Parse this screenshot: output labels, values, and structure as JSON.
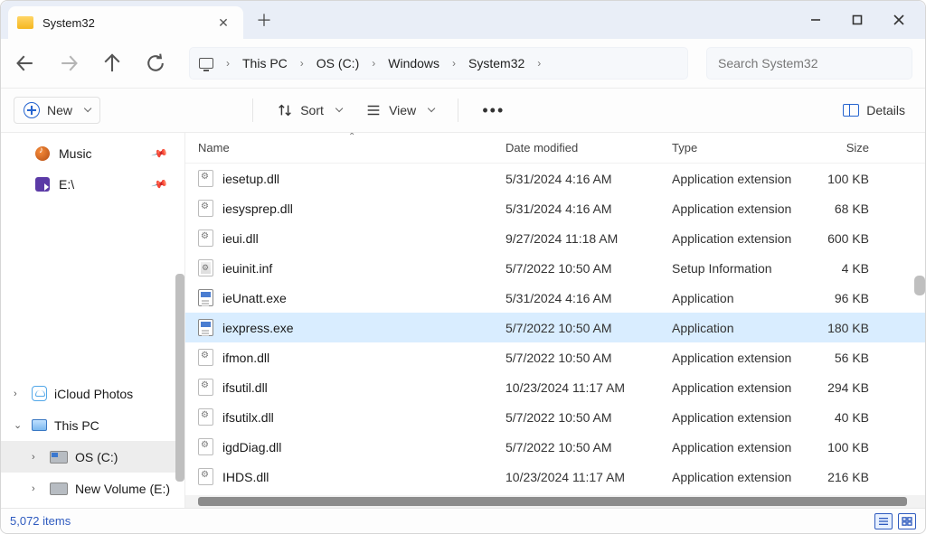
{
  "tab": {
    "title": "System32"
  },
  "breadcrumb": [
    "This PC",
    "OS (C:)",
    "Windows",
    "System32"
  ],
  "search": {
    "placeholder": "Search System32"
  },
  "toolbar": {
    "new_label": "New",
    "sort_label": "Sort",
    "view_label": "View",
    "details_label": "Details"
  },
  "sidebar": {
    "top": [
      {
        "label": "Music",
        "icon": "music-icon",
        "pinned": true
      },
      {
        "label": "E:\\",
        "icon": "drive-e-icon",
        "pinned": true
      }
    ],
    "bottom": [
      {
        "label": "iCloud Photos",
        "icon": "icloud-icon",
        "arrow": "›",
        "indent": 0
      },
      {
        "label": "This PC",
        "icon": "thispc-icon",
        "arrow": "⌄",
        "indent": 0
      },
      {
        "label": "OS (C:)",
        "icon": "osdrive-icon",
        "arrow": "›",
        "indent": 1,
        "selected": true
      },
      {
        "label": "New Volume (E:)",
        "icon": "newvol-icon",
        "arrow": "›",
        "indent": 1
      }
    ]
  },
  "columns": {
    "name": "Name",
    "date": "Date modified",
    "type": "Type",
    "size": "Size"
  },
  "files": [
    {
      "name": "iesetup.dll",
      "date": "5/31/2024 4:16 AM",
      "type": "Application extension",
      "size": "100 KB",
      "ico": "gear"
    },
    {
      "name": "iesysprep.dll",
      "date": "5/31/2024 4:16 AM",
      "type": "Application extension",
      "size": "68 KB",
      "ico": "gear"
    },
    {
      "name": "ieui.dll",
      "date": "9/27/2024 11:18 AM",
      "type": "Application extension",
      "size": "600 KB",
      "ico": "gear"
    },
    {
      "name": "ieuinit.inf",
      "date": "5/7/2022 10:50 AM",
      "type": "Setup Information",
      "size": "4 KB",
      "ico": "inf"
    },
    {
      "name": "ieUnatt.exe",
      "date": "5/31/2024 4:16 AM",
      "type": "Application",
      "size": "96 KB",
      "ico": "exe"
    },
    {
      "name": "iexpress.exe",
      "date": "5/7/2022 10:50 AM",
      "type": "Application",
      "size": "180 KB",
      "ico": "exe",
      "selected": true
    },
    {
      "name": "ifmon.dll",
      "date": "5/7/2022 10:50 AM",
      "type": "Application extension",
      "size": "56 KB",
      "ico": "gear"
    },
    {
      "name": "ifsutil.dll",
      "date": "10/23/2024 11:17 AM",
      "type": "Application extension",
      "size": "294 KB",
      "ico": "gear"
    },
    {
      "name": "ifsutilx.dll",
      "date": "5/7/2022 10:50 AM",
      "type": "Application extension",
      "size": "40 KB",
      "ico": "gear"
    },
    {
      "name": "igdDiag.dll",
      "date": "5/7/2022 10:50 AM",
      "type": "Application extension",
      "size": "100 KB",
      "ico": "gear"
    },
    {
      "name": "IHDS.dll",
      "date": "10/23/2024 11:17 AM",
      "type": "Application extension",
      "size": "216 KB",
      "ico": "gear"
    }
  ],
  "status": {
    "items": "5,072 items"
  }
}
